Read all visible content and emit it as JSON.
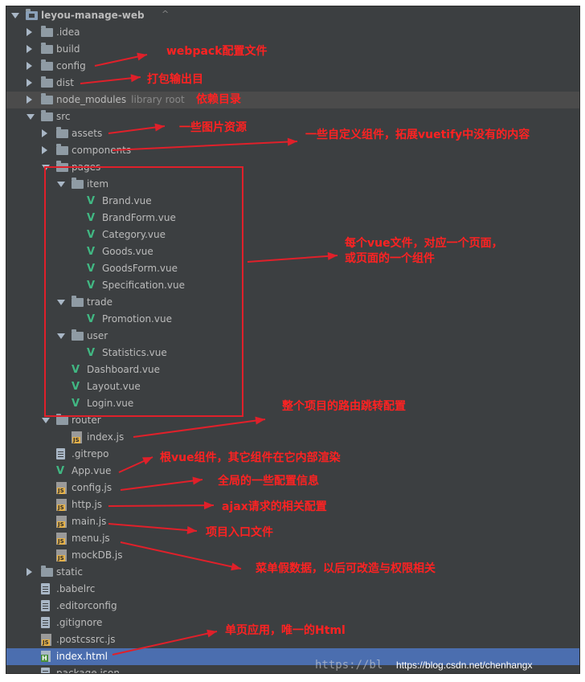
{
  "project": {
    "name": "leyou-manage-web",
    "chevron": "^"
  },
  "tree": [
    {
      "label": "leyou-manage-web",
      "depth": 0,
      "kind": "project",
      "state": "expanded",
      "bold": true
    },
    {
      "label": ".idea",
      "depth": 1,
      "kind": "folder",
      "state": "collapsed"
    },
    {
      "label": "build",
      "depth": 1,
      "kind": "folder",
      "state": "collapsed"
    },
    {
      "label": "config",
      "depth": 1,
      "kind": "folder",
      "state": "collapsed"
    },
    {
      "label": "dist",
      "depth": 1,
      "kind": "folder",
      "state": "collapsed"
    },
    {
      "label": "node_modules",
      "depth": 1,
      "kind": "folder",
      "state": "collapsed",
      "suffix": "library root",
      "highlight": "grey"
    },
    {
      "label": "src",
      "depth": 1,
      "kind": "folder",
      "state": "expanded"
    },
    {
      "label": "assets",
      "depth": 2,
      "kind": "folder",
      "state": "collapsed"
    },
    {
      "label": "components",
      "depth": 2,
      "kind": "folder",
      "state": "collapsed"
    },
    {
      "label": "pages",
      "depth": 2,
      "kind": "folder",
      "state": "expanded"
    },
    {
      "label": "item",
      "depth": 3,
      "kind": "folder",
      "state": "expanded"
    },
    {
      "label": "Brand.vue",
      "depth": 4,
      "kind": "vue"
    },
    {
      "label": "BrandForm.vue",
      "depth": 4,
      "kind": "vue"
    },
    {
      "label": "Category.vue",
      "depth": 4,
      "kind": "vue"
    },
    {
      "label": "Goods.vue",
      "depth": 4,
      "kind": "vue"
    },
    {
      "label": "GoodsForm.vue",
      "depth": 4,
      "kind": "vue"
    },
    {
      "label": "Specification.vue",
      "depth": 4,
      "kind": "vue"
    },
    {
      "label": "trade",
      "depth": 3,
      "kind": "folder",
      "state": "expanded"
    },
    {
      "label": "Promotion.vue",
      "depth": 4,
      "kind": "vue"
    },
    {
      "label": "user",
      "depth": 3,
      "kind": "folder",
      "state": "expanded"
    },
    {
      "label": "Statistics.vue",
      "depth": 4,
      "kind": "vue"
    },
    {
      "label": "Dashboard.vue",
      "depth": 3,
      "kind": "vue"
    },
    {
      "label": "Layout.vue",
      "depth": 3,
      "kind": "vue"
    },
    {
      "label": "Login.vue",
      "depth": 3,
      "kind": "vue"
    },
    {
      "label": "router",
      "depth": 2,
      "kind": "folder",
      "state": "expanded"
    },
    {
      "label": "index.js",
      "depth": 3,
      "kind": "js"
    },
    {
      "label": ".gitrepo",
      "depth": 2,
      "kind": "file"
    },
    {
      "label": "App.vue",
      "depth": 2,
      "kind": "vue"
    },
    {
      "label": "config.js",
      "depth": 2,
      "kind": "js"
    },
    {
      "label": "http.js",
      "depth": 2,
      "kind": "js"
    },
    {
      "label": "main.js",
      "depth": 2,
      "kind": "js"
    },
    {
      "label": "menu.js",
      "depth": 2,
      "kind": "js"
    },
    {
      "label": "mockDB.js",
      "depth": 2,
      "kind": "js"
    },
    {
      "label": "static",
      "depth": 1,
      "kind": "folder",
      "state": "collapsed"
    },
    {
      "label": ".babelrc",
      "depth": 1,
      "kind": "file"
    },
    {
      "label": ".editorconfig",
      "depth": 1,
      "kind": "file"
    },
    {
      "label": ".gitignore",
      "depth": 1,
      "kind": "file"
    },
    {
      "label": ".postcssrc.js",
      "depth": 1,
      "kind": "js"
    },
    {
      "label": "index.html",
      "depth": 1,
      "kind": "html",
      "highlight": "blue"
    },
    {
      "label": "package.json",
      "depth": 1,
      "kind": "file"
    }
  ],
  "annotations": {
    "config": "webpack配置文件",
    "dist": "打包输出目",
    "node_modules": "依赖目录",
    "assets": "一些图片资源",
    "components": "一些自定义组件，拓展vuetify中没有的内容",
    "pages_line1": "每个vue文件，对应一个页面，",
    "pages_line2": "或页面的一个组件",
    "router": "整个项目的路由跳转配置",
    "app_vue": "根vue组件，其它组件在它内部渲染",
    "config_js": "全局的一些配置信息",
    "http_js": "ajax请求的相关配置",
    "main_js": "项目入口文件",
    "menu_js": "菜单假数据，以后可改造与权限相关",
    "index_html": "单页应用，唯一的Html"
  },
  "watermark": {
    "faded": "https://bl",
    "url": "https://blog.csdn.net/chenhangx"
  },
  "colors": {
    "panel_bg": "#3c3f41",
    "highlight_grey": "#4b4b4b",
    "selected_blue": "#4b6eaf",
    "vue_green": "#41b883",
    "annotation_red": "#ff2222"
  }
}
